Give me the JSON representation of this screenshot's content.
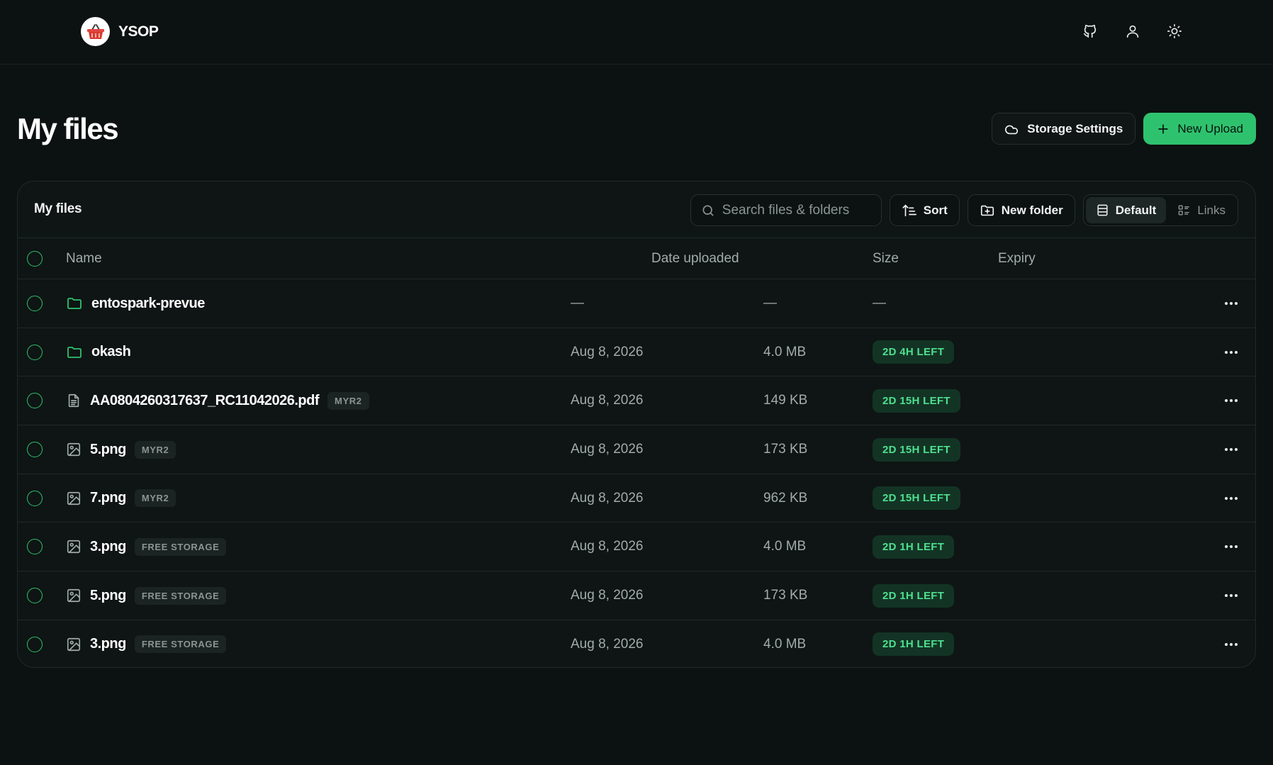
{
  "brand": {
    "name": "YSOP",
    "logo_icon": "basket-icon"
  },
  "topbar": {
    "icons": [
      "github-icon",
      "user-icon",
      "sun-icon"
    ]
  },
  "page": {
    "title": "My files",
    "storage_settings_label": "Storage Settings",
    "new_upload_label": "New Upload"
  },
  "panel": {
    "title": "My files",
    "search_placeholder": "Search files & folders",
    "sort_label": "Sort",
    "new_folder_label": "New folder",
    "view_default_label": "Default",
    "view_links_label": "Links"
  },
  "columns": {
    "name": "Name",
    "date": "Date uploaded",
    "size": "Size",
    "expiry": "Expiry"
  },
  "files": [
    {
      "type": "folder",
      "name": "entospark-prevue",
      "tag": "",
      "date": "—",
      "size": "—",
      "expiry": "—"
    },
    {
      "type": "folder",
      "name": "okash",
      "tag": "",
      "date": "Aug 8, 2026",
      "size": "4.0 MB",
      "expiry": "2D 4H LEFT"
    },
    {
      "type": "document",
      "name": "AA0804260317637_RC11042026.pdf",
      "tag": "MYR2",
      "date": "Aug 8, 2026",
      "size": "149 KB",
      "expiry": "2D 15H LEFT"
    },
    {
      "type": "image",
      "name": "5.png",
      "tag": "MYR2",
      "date": "Aug 8, 2026",
      "size": "173 KB",
      "expiry": "2D 15H LEFT"
    },
    {
      "type": "image",
      "name": "7.png",
      "tag": "MYR2",
      "date": "Aug 8, 2026",
      "size": "962 KB",
      "expiry": "2D 15H LEFT"
    },
    {
      "type": "image",
      "name": "3.png",
      "tag": "FREE STORAGE",
      "date": "Aug 8, 2026",
      "size": "4.0 MB",
      "expiry": "2D 1H LEFT"
    },
    {
      "type": "image",
      "name": "5.png",
      "tag": "FREE STORAGE",
      "date": "Aug 8, 2026",
      "size": "173 KB",
      "expiry": "2D 1H LEFT"
    },
    {
      "type": "image",
      "name": "3.png",
      "tag": "FREE STORAGE",
      "date": "Aug 8, 2026",
      "size": "4.0 MB",
      "expiry": "2D 1H LEFT"
    }
  ],
  "colors": {
    "accent": "#2fc26e",
    "background": "#0c1211",
    "badge_text": "#4fe08f",
    "badge_bg": "#133425"
  }
}
